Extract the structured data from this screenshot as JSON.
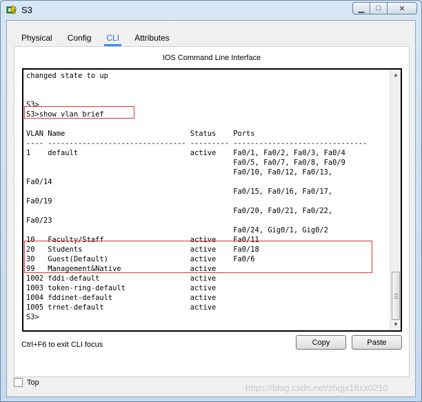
{
  "window": {
    "title": "S3",
    "minimize_icon": "minimize-icon",
    "maximize_icon": "maximize-icon",
    "close_icon": "close-icon",
    "minimize_glyph": "▁",
    "maximize_glyph": "□",
    "close_glyph": "✕"
  },
  "tabs": [
    {
      "label": "Physical",
      "active": false
    },
    {
      "label": "Config",
      "active": false
    },
    {
      "label": "CLI",
      "active": true
    },
    {
      "label": "Attributes",
      "active": false
    }
  ],
  "cli": {
    "header": "IOS Command Line Interface",
    "lines": [
      "changed state to up",
      "",
      "",
      "S3>",
      "S3>show vlan brief",
      "",
      "VLAN Name                             Status    Ports",
      "---- -------------------------------- --------- -------------------------------",
      "1    default                          active    Fa0/1, Fa0/2, Fa0/3, Fa0/4",
      "                                                Fa0/5, Fa0/7, Fa0/8, Fa0/9",
      "                                                Fa0/10, Fa0/12, Fa0/13,",
      "Fa0/14",
      "                                                Fa0/15, Fa0/16, Fa0/17,",
      "Fa0/19",
      "                                                Fa0/20, Fa0/21, Fa0/22,",
      "Fa0/23",
      "                                                Fa0/24, Gig0/1, Gig0/2",
      "10   Faculty/Staff                    active    Fa0/11",
      "20   Students                         active    Fa0/18",
      "30   Guest(Default)                   active    Fa0/6",
      "99   Management&Native                active",
      "1002 fddi-default                     active",
      "1003 token-ring-default               active",
      "1004 fddinet-default                  active",
      "1005 trnet-default                    active",
      "S3>"
    ],
    "scroll_up_glyph": "▲",
    "scroll_down_glyph": "▼"
  },
  "footer": {
    "hint": "Ctrl+F6 to exit CLI focus",
    "copy_label": "Copy",
    "paste_label": "Paste"
  },
  "top_checkbox": {
    "label": "Top",
    "checked": false
  },
  "watermark": "https://blog.csdn.net/zhgjx16xx0210",
  "colors": {
    "highlight": "#d9333b",
    "active_tab": "#2a6fc9",
    "tab_underline": "#3b8ee3"
  }
}
